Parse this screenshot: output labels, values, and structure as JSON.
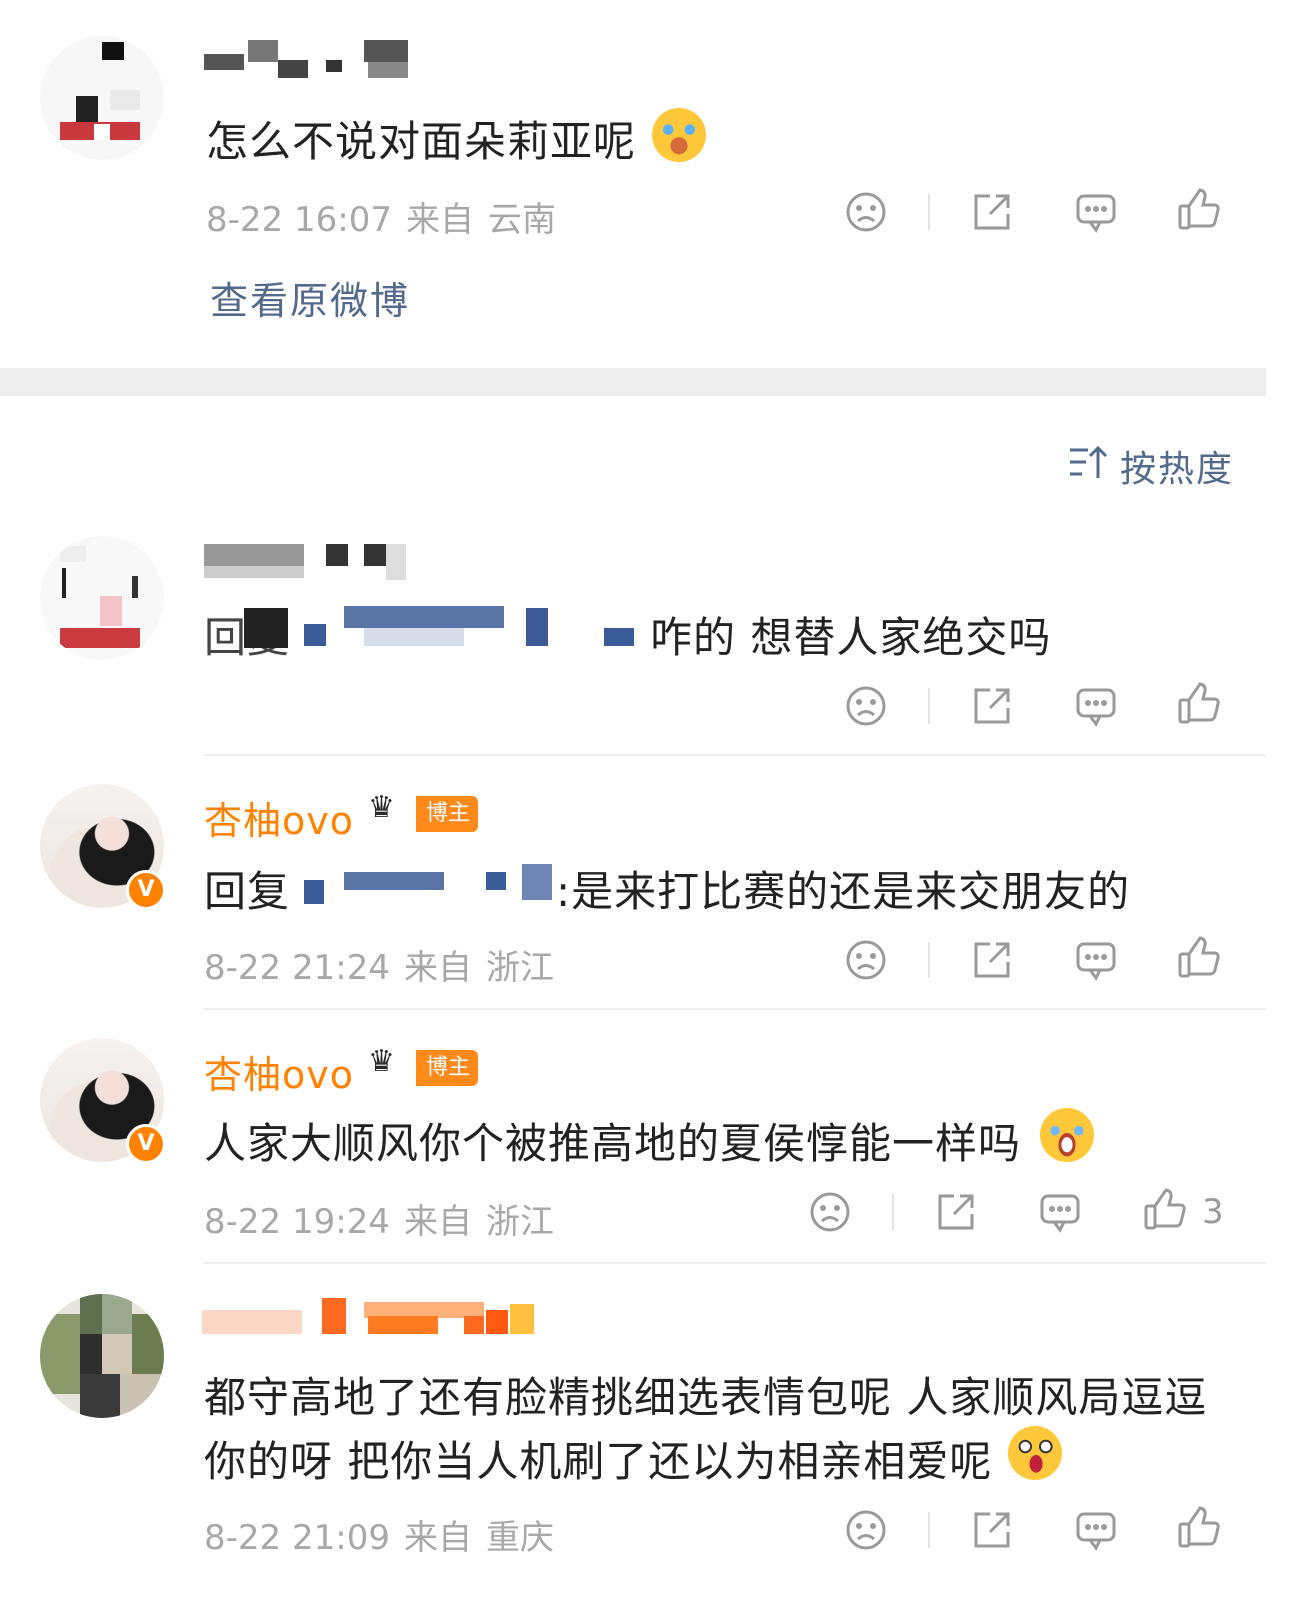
{
  "post": {
    "text": "怎么不说对面朵莉亚呢",
    "emoji_name": "laugh-cry-emoji",
    "date": "8-22 16:07",
    "from": "来自",
    "location": "云南",
    "view_original": "查看原微博"
  },
  "sort_label": "按热度",
  "comments": [
    {
      "text_suffix": "咋的 想替人家绝交吗",
      "text_prefix": "回复"
    },
    {
      "username": "杏柚ovo",
      "badge": "博主",
      "reply_prefix": "回复",
      "text_suffix": ":是来打比赛的还是来交朋友的",
      "date": "8-22 21:24",
      "from": "来自",
      "location": "浙江"
    },
    {
      "username": "杏柚ovo",
      "badge": "博主",
      "text": "人家大顺风你个被推高地的夏侯惇能一样吗",
      "emoji_name": "laughing-emoji",
      "date": "8-22 19:24",
      "from": "来自",
      "location": "浙江",
      "likes": "3"
    },
    {
      "text_line1": "都守高地了还有脸精挑细选表情包呢 人家顺风局逗逗",
      "text_line2": "你的呀 把你当人机刷了还以为相亲相爱呢",
      "emoji_name": "drooling-emoji",
      "date": "8-22 21:09",
      "from": "来自",
      "location": "重庆"
    }
  ],
  "colors": {
    "username": "#ff8200",
    "link": "#536a8c",
    "meta": "#a8a8a8",
    "icon": "#9a9a9a",
    "badge": "#ff8a1a"
  },
  "icons": [
    "dislike-icon",
    "share-icon",
    "comment-icon",
    "like-icon",
    "sort-icon",
    "verified-icon",
    "crown-icon"
  ]
}
